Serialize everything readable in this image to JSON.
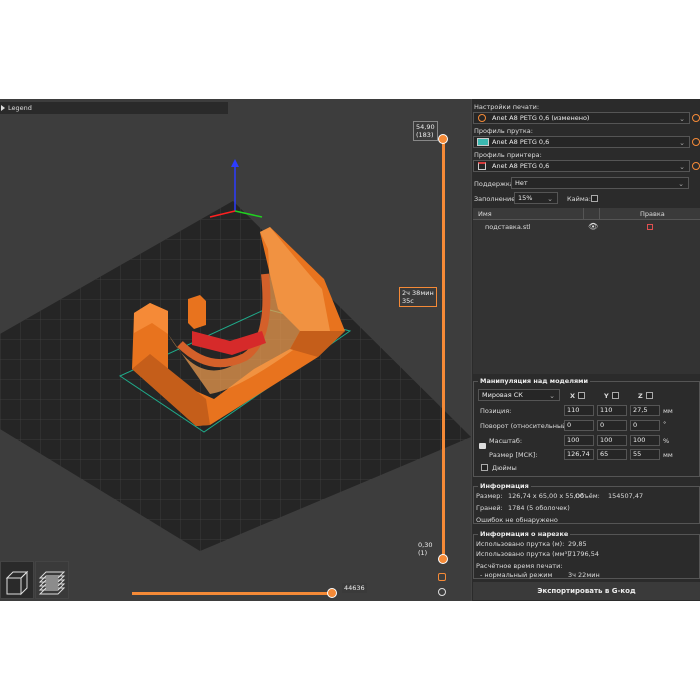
{
  "viewport": {
    "legend_label": "Legend",
    "top_height_label": "54,90",
    "top_layer_label": "(183)",
    "time_label_1": "2ч 38мин",
    "time_label_2": "35с",
    "bottom_height_label": "0,30",
    "bottom_layer_label": "(1)",
    "h_slider_value": "44636"
  },
  "print_settings": {
    "label": "Настройки печати:",
    "value": "Anet A8 PETG 0,6 (изменено)"
  },
  "filament": {
    "label": "Профиль прутка:",
    "value": "Anet A8 PETG 0,6",
    "color": "#3ab8b0"
  },
  "printer": {
    "label": "Профиль принтера:",
    "value": "Anet A8 PETG 0,6"
  },
  "supports": {
    "label": "Поддержка:",
    "value": "Нет"
  },
  "infill": {
    "label": "Заполнение:",
    "value": "15%",
    "brim_label": "Кайма:"
  },
  "object_list": {
    "col_name": "Имя",
    "col_edit": "Правка",
    "items": [
      {
        "name": "подставка.stl"
      }
    ]
  },
  "manipulation": {
    "title": "Манипуляция над моделями",
    "coord_system": "Мировая СК",
    "axis_x": "X",
    "axis_y": "Y",
    "axis_z": "Z",
    "position_label": "Позиция:",
    "position": [
      "110",
      "110",
      "27,5"
    ],
    "position_unit": "мм",
    "rotation_label": "Поворот (относительный):",
    "rotation": [
      "0",
      "0",
      "0"
    ],
    "rotation_unit": "°",
    "scale_label": "Масштаб:",
    "scale": [
      "100",
      "100",
      "100"
    ],
    "scale_unit": "%",
    "size_label": "Размер [МСК]:",
    "size": [
      "126,74",
      "65",
      "55"
    ],
    "size_unit": "мм",
    "inches_label": "Дюймы"
  },
  "info": {
    "title": "Информация",
    "size_label": "Размер:",
    "size_value": "126,74 x 65,00 x 55,00",
    "volume_label": "Объём:",
    "volume_value": "154507,47",
    "facets_label": "Граней:",
    "facets_value": "1784 (5 оболочек)",
    "errors": "Ошибок не обнаружено"
  },
  "slice_info": {
    "title": "Информация о нарезке",
    "used_m_label": "Использовано прутка (м):",
    "used_m_value": "29,85",
    "used_mm3_label": "Использовано прутка (мм³):",
    "used_mm3_value": "71796,54",
    "time_label": "Расчётное время печати:",
    "mode_label": "- нормальный режим",
    "mode_value": "3ч 22мин"
  },
  "export_label": "Экспортировать в G-код",
  "colors": {
    "accent": "#f58a37",
    "model": "#e8731e",
    "bed": "#1e1e1e"
  }
}
